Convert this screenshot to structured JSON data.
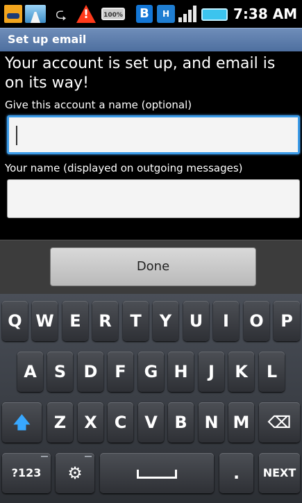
{
  "status_bar": {
    "battery_percent_label": "100%",
    "bluetooth_glyph": "B",
    "network_label": "H",
    "time": "7:38 AM",
    "icons": [
      "voicemail-icon",
      "road-icon",
      "usb-icon",
      "warning-icon",
      "battery-full-icon",
      "bluetooth-icon",
      "data-hplus-icon",
      "signal-icon",
      "battery-icon"
    ]
  },
  "title_bar": {
    "title": "Set up email"
  },
  "content": {
    "headline": "Your account is set up, and email is on its way!",
    "account_name_label": "Give this account a name (optional)",
    "account_name_value": "",
    "your_name_label": "Your name (displayed on outgoing messages)",
    "your_name_value": ""
  },
  "button_bar": {
    "done_label": "Done"
  },
  "keyboard": {
    "row1": [
      "Q",
      "W",
      "E",
      "R",
      "T",
      "Y",
      "U",
      "I",
      "O",
      "P"
    ],
    "row2": [
      "A",
      "S",
      "D",
      "F",
      "G",
      "H",
      "J",
      "K",
      "L"
    ],
    "row3": [
      "Z",
      "X",
      "C",
      "V",
      "B",
      "N",
      "M"
    ],
    "mode_label": "?123",
    "period_label": ".",
    "next_label": "NEXT",
    "icons": [
      "shift-icon",
      "backspace-icon",
      "settings-icon",
      "space-icon"
    ]
  },
  "colors": {
    "title_bar": "#5b7aa9",
    "focus_border": "#3b9be8",
    "shift_accent": "#38a8ff"
  }
}
